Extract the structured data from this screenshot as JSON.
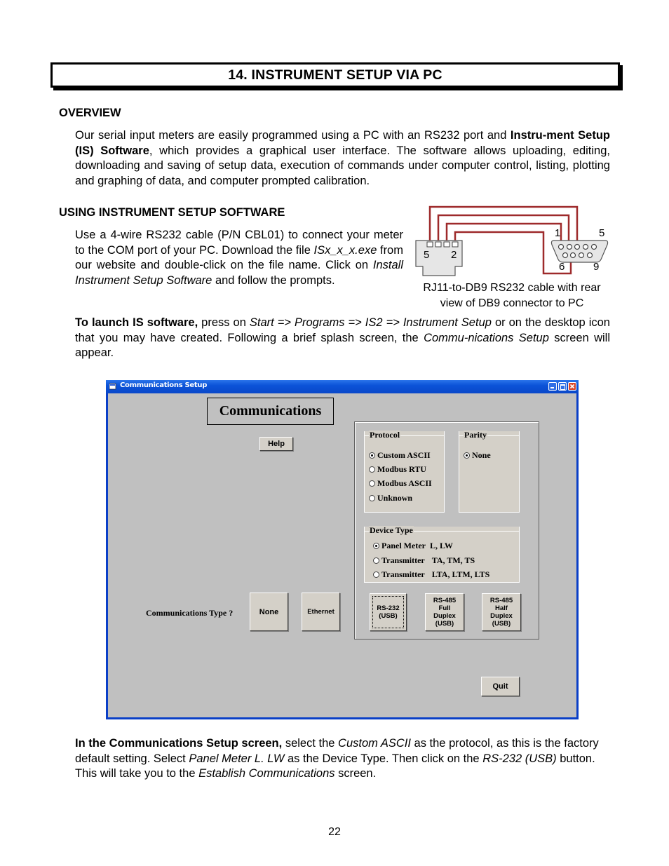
{
  "section_title": "14.  INSTRUMENT SETUP VIA PC",
  "overview": {
    "heading": "OVERVIEW",
    "text_1": "Our serial input meters are easily programmed using a PC with an RS232 port and ",
    "bold_1": "Instru-ment Setup (IS) Software",
    "text_2": ", which provides a graphical user interface. The software allows uploading, editing, downloading and saving of setup data, execution of commands under computer control, listing, plotting and graphing of data, and computer prompted calibration."
  },
  "using": {
    "heading": "USING INSTRUMENT SETUP SOFTWARE",
    "text_1": "Use a 4-wire RS232 cable (P/N CBL01) to connect your meter to the COM port of your PC. Download the file ",
    "italic_1": "ISx_x_x.exe",
    "text_2": " from our website and double-click on the file name. Click on ",
    "italic_2": "Install Instrument Setup Software",
    "text_3": " and follow the prompts."
  },
  "cable_diagram": {
    "rj11_pins": [
      "5",
      "2"
    ],
    "db9_pins": [
      "1",
      "5",
      "6",
      "9"
    ],
    "caption_line1": "RJ11-to-DB9 RS232 cable with rear",
    "caption_line2": "view of DB9 connector to PC",
    "wire_color": "#9e2a2b"
  },
  "launch": {
    "bold": "To launch IS software,",
    "text_1": " press on ",
    "italic_1": "Start => Programs => IS2 => Instrument Setup",
    "text_2": " or on the desktop icon that you may have created. Following a brief splash screen, the ",
    "italic_2": "Commu-nications Setup",
    "text_3": " screen will appear."
  },
  "window": {
    "title": "Communications Setup",
    "heading": "Communications",
    "help_label": "Help",
    "protocol": {
      "label": "Protocol",
      "options": [
        {
          "label": "Custom ASCII",
          "selected": true
        },
        {
          "label": "Modbus RTU",
          "selected": false
        },
        {
          "label": "Modbus ASCII",
          "selected": false
        },
        {
          "label": "Unknown",
          "selected": false
        }
      ]
    },
    "parity": {
      "label": "Parity",
      "options": [
        {
          "label": "None",
          "selected": true
        }
      ]
    },
    "device_type": {
      "label": "Device Type",
      "options": [
        {
          "label": "Panel Meter",
          "models": "L, LW",
          "selected": true
        },
        {
          "label": "Transmitter",
          "models": "TA, TM, TS",
          "selected": false
        },
        {
          "label": "Transmitter",
          "models": "LTA, LTM, LTS",
          "selected": false
        }
      ]
    },
    "comm_type_label": "Communications Type ?",
    "buttons": {
      "none": "None",
      "ethernet": "Ethernet",
      "rs232": [
        "RS-232",
        "(USB)"
      ],
      "rs485_full": [
        "RS-485",
        "Full",
        "Duplex",
        "(USB)"
      ],
      "rs485_half": [
        "RS-485",
        "Half",
        "Duplex",
        "(USB)"
      ],
      "quit": "Quit"
    }
  },
  "instructions": {
    "bold": "In the Communications Setup screen,",
    "text_1": " select the ",
    "italic_1": "Custom ASCII",
    "text_2": " as the protocol, as this is the factory default setting. Select ",
    "italic_2": "Panel Meter L. LW",
    "text_3": " as the Device Type. Then click on the ",
    "italic_3": "RS-232 (USB)",
    "text_4": " button. This will take you to the ",
    "italic_4": "Establish Communications",
    "text_5": " screen."
  },
  "page_number": "22"
}
